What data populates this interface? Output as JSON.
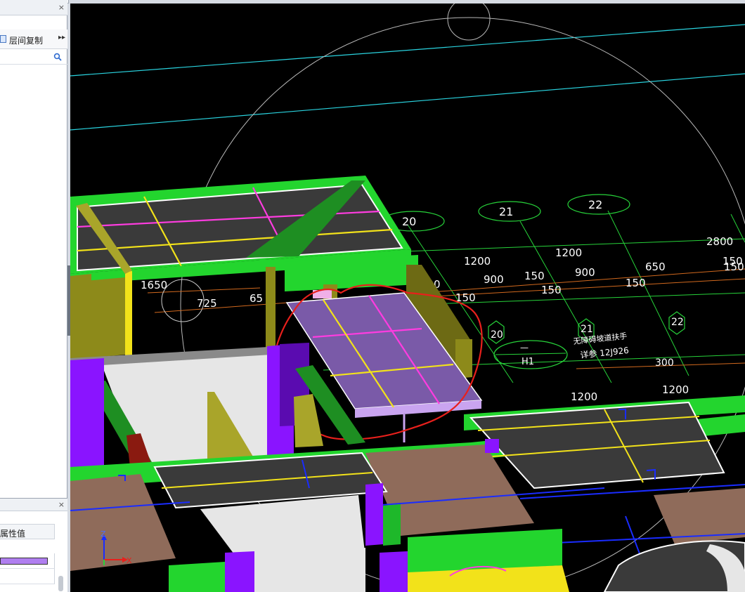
{
  "left_panel": {
    "close_glyph": "×",
    "toolbar": {
      "copy_label": "层间复制",
      "more_glyph": "▸▸"
    },
    "search": {
      "placeholder": "",
      "icon": "search-icon"
    }
  },
  "properties_panel": {
    "close_glyph": "×",
    "header_label": "属性值",
    "rows": [
      {
        "value_color": "#b07ff0"
      },
      {
        "value_color": ""
      }
    ]
  },
  "viewport": {
    "axis_labels": {
      "z": "Z",
      "x": "X"
    },
    "grid_bubbles_top": [
      "20",
      "21",
      "22"
    ],
    "grid_bubbles_lower": [
      "20",
      "21",
      "22"
    ],
    "dims_row1": [
      "1200",
      "1200",
      "2800",
      "150"
    ],
    "dims_row2": [
      "0",
      "900",
      "150",
      "900",
      "650",
      "150"
    ],
    "dims_row3": [
      "150",
      "150"
    ],
    "dims_left": [
      "1650",
      "725",
      "65"
    ],
    "dims_lower_right": [
      "300"
    ],
    "dims_bottom": [
      "1200",
      "1200"
    ],
    "annotation": {
      "tag_top": "—",
      "tag_bottom": "H1",
      "line1": "无障碍坡道扶手",
      "line2": "详参  12J926"
    }
  },
  "colors": {
    "background": "#000000",
    "cyan_grid": "#2ad4e0",
    "green_grid": "#27d33a",
    "orange_dim": "#d2691e",
    "wall_green": "#23d52e",
    "column_purple": "#8a14ff",
    "slab_purple": "#7a5aa8",
    "highlight_red": "#e8201c",
    "rebar_yellow": "#f2e21a",
    "rebar_magenta": "#ff3ce0",
    "beam_olive": "#8d8a1a",
    "floor_brown": "#8f6b5a"
  }
}
